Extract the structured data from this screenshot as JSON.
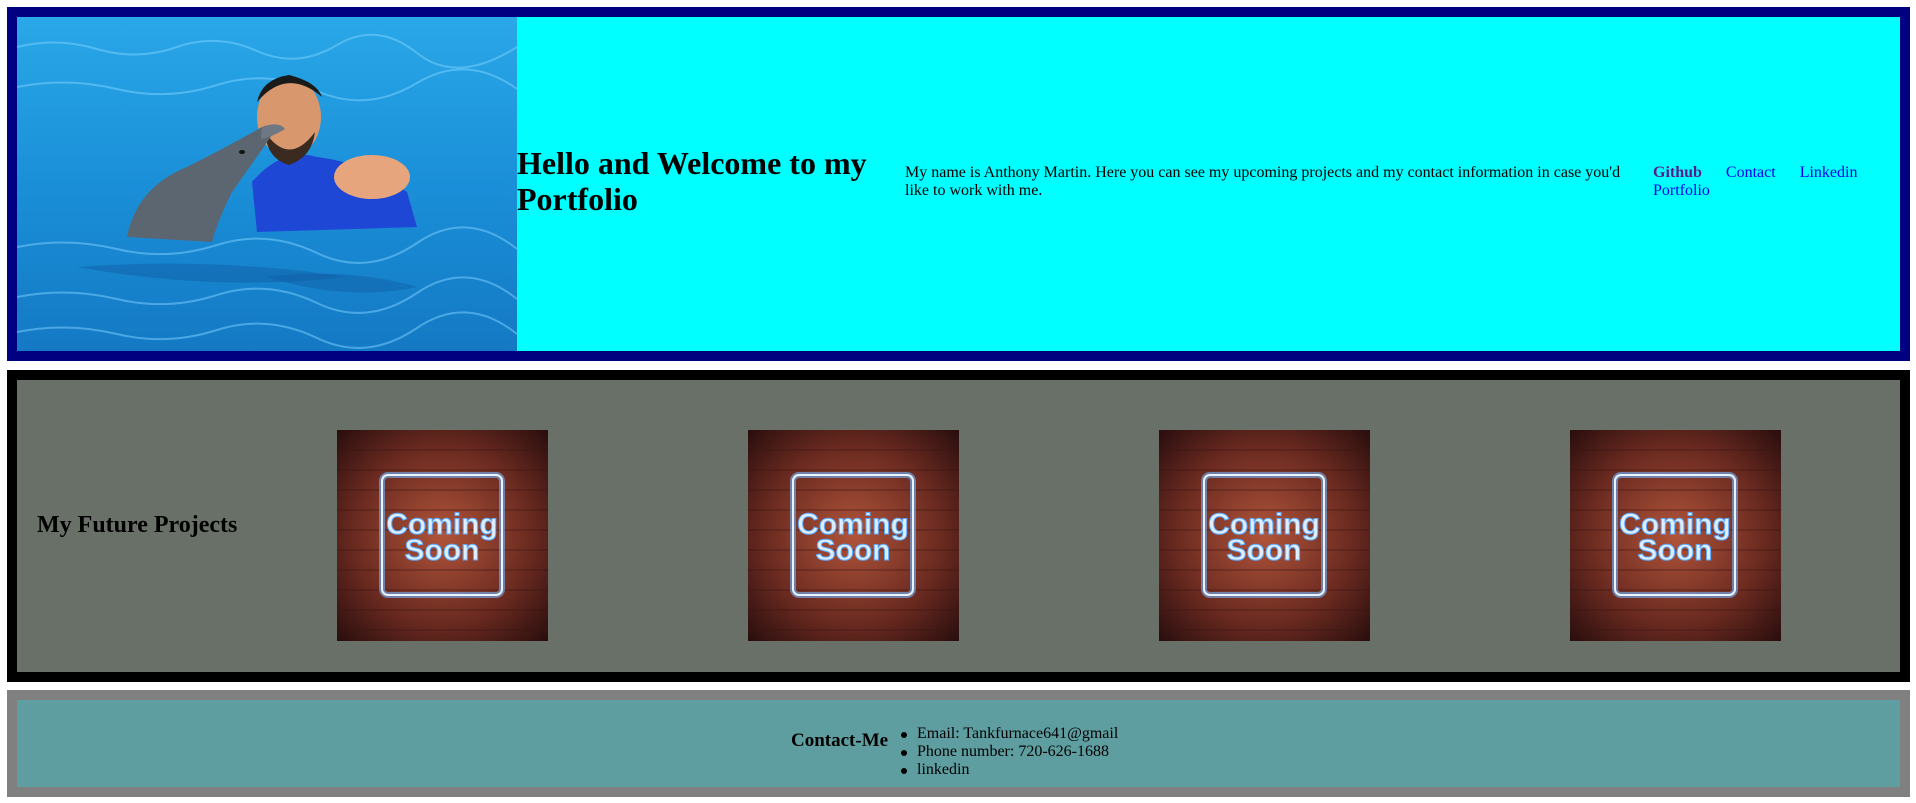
{
  "header": {
    "photo_alt": "Anthony with a dolphin in a pool",
    "welcome_title": "Hello and Welcome to my Portfolio",
    "about_text": "My name is Anthony Martin. Here you can see my upcoming projects and my contact information in case you'd like to work with me.",
    "nav": {
      "brand": "Github",
      "contact": "Contact",
      "linkedin": "Linkedin",
      "portfolio": "Portfolio"
    }
  },
  "projects": {
    "title": "My Future Projects",
    "cards": [
      {
        "line1": "Coming",
        "line2": "Soon"
      },
      {
        "line1": "Coming",
        "line2": "Soon"
      },
      {
        "line1": "Coming",
        "line2": "Soon"
      },
      {
        "line1": "Coming",
        "line2": "Soon"
      }
    ]
  },
  "contact": {
    "title": "Contact-Me",
    "items": [
      "Email: Tankfurnace641@gmail",
      "Phone number: 720-626-1688",
      "linkedin"
    ]
  },
  "colors": {
    "header_border": "#000080",
    "header_bg": "#00ffff",
    "projects_border": "#000000",
    "projects_bg": "#697068",
    "contact_border": "#808080",
    "contact_bg": "#5f9ea0"
  }
}
